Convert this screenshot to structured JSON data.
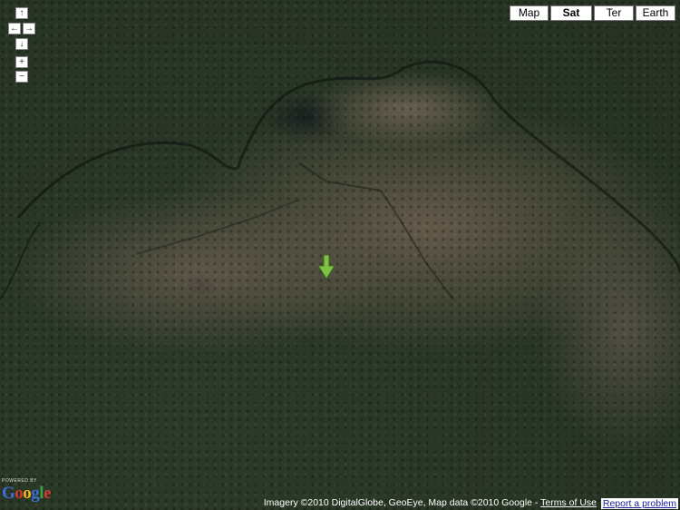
{
  "map": {
    "type_buttons": [
      {
        "label": "Map",
        "selected": false
      },
      {
        "label": "Sat",
        "selected": true
      },
      {
        "label": "Ter",
        "selected": false
      },
      {
        "label": "Earth",
        "selected": false
      }
    ],
    "nav": {
      "up_icon": "↑",
      "left_icon": "←",
      "right_icon": "→",
      "down_icon": "↓",
      "zoom_in": "+",
      "zoom_out": "−"
    },
    "marker_color": "#7dc242",
    "logo": {
      "powered_by": "POWERED BY",
      "brand": "Google",
      "brand_colors": [
        "#3b6fd4",
        "#d43b2f",
        "#f2b51c",
        "#3b6fd4",
        "#3aa04a",
        "#d43b2f"
      ]
    },
    "attribution": {
      "text": "Imagery ©2010 DigitalGlobe, GeoEye, Map data ©2010 Google - ",
      "terms_link": "Terms of Use"
    },
    "report_problem": "Report a problem"
  }
}
